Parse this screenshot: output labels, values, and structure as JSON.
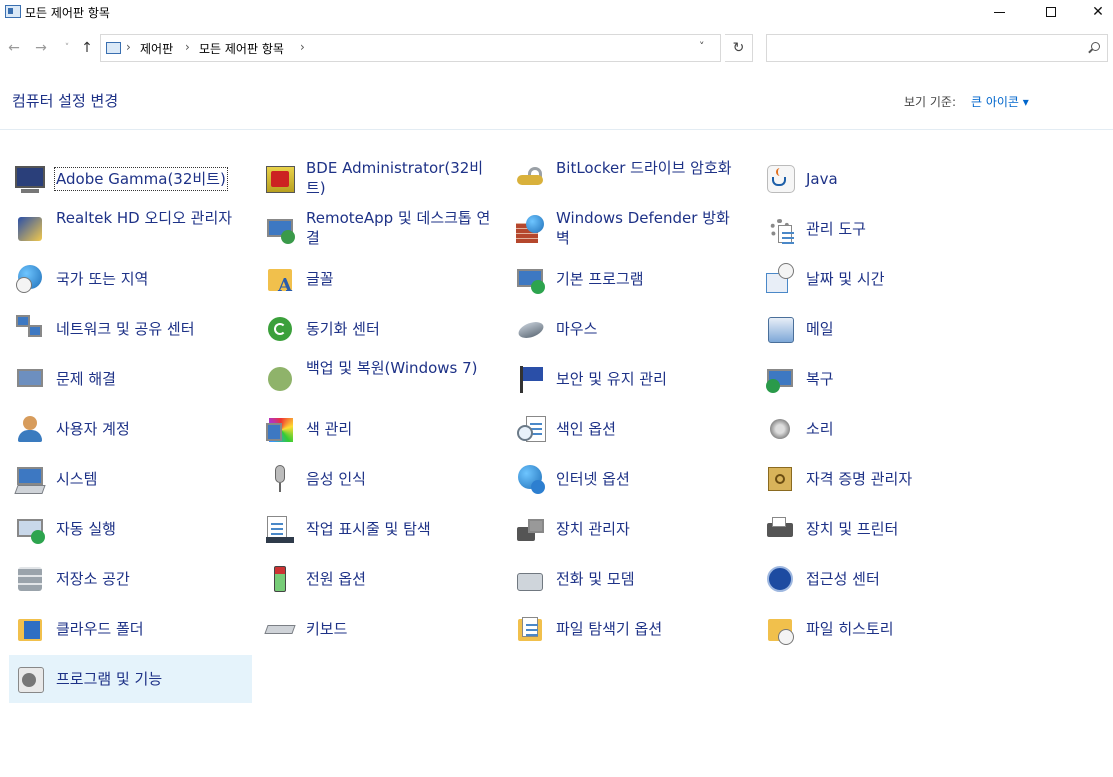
{
  "window": {
    "title": "모든 제어판 항목",
    "minimize_glyph": "",
    "close_glyph": "✕"
  },
  "nav": {
    "back_glyph": "←",
    "forward_glyph": "→",
    "recent_glyph": "˅",
    "up_glyph": "↑",
    "breadcrumbs": [
      "제어판",
      "모든 제어판 항목"
    ],
    "separator": "›",
    "dropdown_glyph": "˅",
    "refresh_glyph": "↻",
    "search_placeholder": ""
  },
  "header": {
    "title": "컴퓨터 설정 변경",
    "view_by_label": "보기 기준:",
    "view_by_value": "큰 아이콘 ▾"
  },
  "items": [
    {
      "label": "Adobe Gamma(32비트)",
      "icon": "monitor-gamma-icon",
      "focused": true
    },
    {
      "label": "BDE Administrator(32비트)",
      "icon": "bde-admin-icon"
    },
    {
      "label": "BitLocker 드라이브 암호화",
      "icon": "bitlocker-key-icon"
    },
    {
      "label": "Java",
      "icon": "java-cup-icon"
    },
    {
      "label": "Realtek HD 오디오 관리자",
      "icon": "realtek-audio-icon"
    },
    {
      "label": "RemoteApp 및 데스크톱 연결",
      "icon": "remote-desktop-icon"
    },
    {
      "label": "Windows Defender 방화벽",
      "icon": "firewall-icon"
    },
    {
      "label": "관리 도구",
      "icon": "admin-tools-icon"
    },
    {
      "label": "국가 또는 지역",
      "icon": "region-globe-icon"
    },
    {
      "label": "글꼴",
      "icon": "fonts-folder-icon"
    },
    {
      "label": "기본 프로그램",
      "icon": "default-programs-icon"
    },
    {
      "label": "날짜 및 시간",
      "icon": "date-time-icon"
    },
    {
      "label": "네트워크 및 공유 센터",
      "icon": "network-icon"
    },
    {
      "label": "동기화 센터",
      "icon": "sync-center-icon"
    },
    {
      "label": "마우스",
      "icon": "mouse-icon"
    },
    {
      "label": "메일",
      "icon": "mail-icon"
    },
    {
      "label": "문제 해결",
      "icon": "troubleshoot-icon"
    },
    {
      "label": "백업 및 복원(Windows 7)",
      "icon": "backup-restore-icon"
    },
    {
      "label": "보안 및 유지 관리",
      "icon": "security-flag-icon"
    },
    {
      "label": "복구",
      "icon": "recovery-icon"
    },
    {
      "label": "사용자 계정",
      "icon": "user-accounts-icon"
    },
    {
      "label": "색 관리",
      "icon": "color-management-icon"
    },
    {
      "label": "색인 옵션",
      "icon": "indexing-icon"
    },
    {
      "label": "소리",
      "icon": "sound-speaker-icon"
    },
    {
      "label": "시스템",
      "icon": "system-laptop-icon"
    },
    {
      "label": "음성 인식",
      "icon": "microphone-icon"
    },
    {
      "label": "인터넷 옵션",
      "icon": "internet-options-icon"
    },
    {
      "label": "자격 증명 관리자",
      "icon": "credential-vault-icon"
    },
    {
      "label": "자동 실행",
      "icon": "autoplay-icon"
    },
    {
      "label": "작업 표시줄 및 탐색",
      "icon": "taskbar-icon"
    },
    {
      "label": "장치 관리자",
      "icon": "device-manager-icon"
    },
    {
      "label": "장치 및 프린터",
      "icon": "printer-icon"
    },
    {
      "label": "저장소 공간",
      "icon": "storage-spaces-icon"
    },
    {
      "label": "전원 옵션",
      "icon": "power-battery-icon"
    },
    {
      "label": "전화 및 모뎀",
      "icon": "phone-modem-icon"
    },
    {
      "label": "접근성 센터",
      "icon": "ease-of-access-icon"
    },
    {
      "label": "클라우드 폴더",
      "icon": "cloud-folder-icon"
    },
    {
      "label": "키보드",
      "icon": "keyboard-icon"
    },
    {
      "label": "파일 탐색기 옵션",
      "icon": "explorer-options-icon"
    },
    {
      "label": "파일 히스토리",
      "icon": "file-history-icon"
    },
    {
      "label": "프로그램 및 기능",
      "icon": "programs-features-icon",
      "selected": true
    }
  ]
}
